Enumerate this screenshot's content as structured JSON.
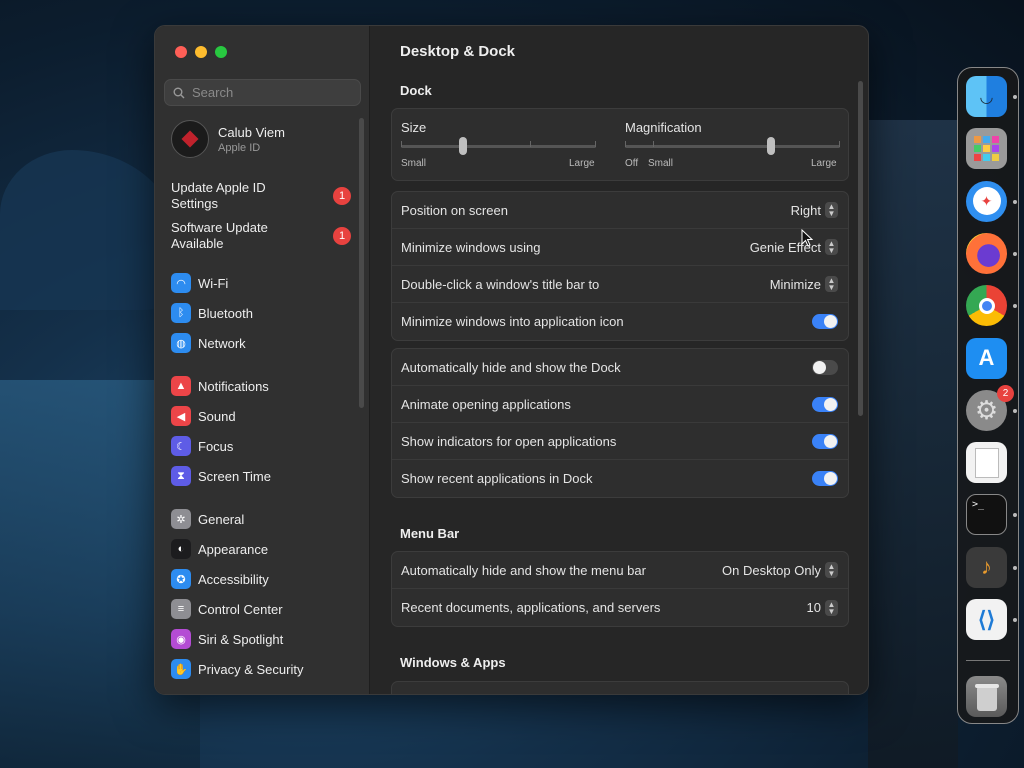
{
  "window": {
    "title": "Desktop & Dock"
  },
  "sidebar": {
    "search_placeholder": "Search",
    "account": {
      "name": "Calub Viem",
      "sub": "Apple ID"
    },
    "notices": [
      {
        "label": "Update Apple ID Settings",
        "badge": "1"
      },
      {
        "label": "Software Update Available",
        "badge": "1"
      }
    ],
    "items": [
      {
        "label": "Wi-Fi",
        "icon": "wifi-icon",
        "color": "#2d8cf0"
      },
      {
        "label": "Bluetooth",
        "icon": "bluetooth-icon",
        "color": "#2d8cf0"
      },
      {
        "label": "Network",
        "icon": "globe-icon",
        "color": "#2d8cf0"
      },
      {
        "label": "Notifications",
        "icon": "bell-icon",
        "color": "#ec4548"
      },
      {
        "label": "Sound",
        "icon": "speaker-icon",
        "color": "#ec4548"
      },
      {
        "label": "Focus",
        "icon": "moon-icon",
        "color": "#5e5ce6"
      },
      {
        "label": "Screen Time",
        "icon": "hourglass-icon",
        "color": "#5e5ce6"
      },
      {
        "label": "General",
        "icon": "gear-icon",
        "color": "#8e8e93"
      },
      {
        "label": "Appearance",
        "icon": "appearance-icon",
        "color": "#1c1c1e"
      },
      {
        "label": "Accessibility",
        "icon": "accessibility-icon",
        "color": "#2d8cf0"
      },
      {
        "label": "Control Center",
        "icon": "toggles-icon",
        "color": "#8e8e93"
      },
      {
        "label": "Siri & Spotlight",
        "icon": "siri-icon",
        "color": "#b44cd4"
      },
      {
        "label": "Privacy & Security",
        "icon": "hand-icon",
        "color": "#2d8cf0"
      }
    ]
  },
  "main": {
    "title": "Desktop & Dock",
    "dock_section": "Dock",
    "size": {
      "label": "Size",
      "min": "Small",
      "max": "Large",
      "value": 0.32
    },
    "magnification": {
      "label": "Magnification",
      "off": "Off",
      "min": "Small",
      "max": "Large",
      "value": 0.68
    },
    "position_rows": [
      {
        "label": "Position on screen",
        "value": "Right",
        "control": "popup"
      },
      {
        "label": "Minimize windows using",
        "value": "Genie Effect",
        "control": "popup"
      },
      {
        "label": "Double-click a window's title bar to",
        "value": "Minimize",
        "control": "popup"
      },
      {
        "label": "Minimize windows into application icon",
        "value": "on",
        "control": "toggle"
      }
    ],
    "behavior_rows": [
      {
        "label": "Automatically hide and show the Dock",
        "value": "off"
      },
      {
        "label": "Animate opening applications",
        "value": "on"
      },
      {
        "label": "Show indicators for open applications",
        "value": "on"
      },
      {
        "label": "Show recent applications in Dock",
        "value": "on"
      }
    ],
    "menubar_section": "Menu Bar",
    "menubar_rows": [
      {
        "label": "Automatically hide and show the menu bar",
        "value": "On Desktop Only"
      },
      {
        "label": "Recent documents, applications, and servers",
        "value": "10"
      }
    ],
    "windows_section": "Windows & Apps"
  },
  "dock": {
    "apps": [
      {
        "name": "finder-icon",
        "color": "#4aa6f0"
      },
      {
        "name": "launchpad-icon",
        "color": "#9a9a9a"
      },
      {
        "name": "safari-icon",
        "color": "#2f8ff0"
      },
      {
        "name": "firefox-icon",
        "color": "#ff7139"
      },
      {
        "name": "chrome-icon",
        "color": "#f2f2f2"
      },
      {
        "name": "app-store-icon",
        "color": "#1e8ef2"
      },
      {
        "name": "system-settings-icon",
        "color": "#8a8a8a"
      },
      {
        "name": "textedit-icon",
        "color": "#f2f2f2"
      },
      {
        "name": "terminal-icon",
        "color": "#111111"
      },
      {
        "name": "garageband-icon",
        "color": "#3a3a3a"
      },
      {
        "name": "vscode-icon",
        "color": "#f2f2f2"
      }
    ],
    "settings_badge": "2",
    "terminal_glyph": ">_"
  }
}
